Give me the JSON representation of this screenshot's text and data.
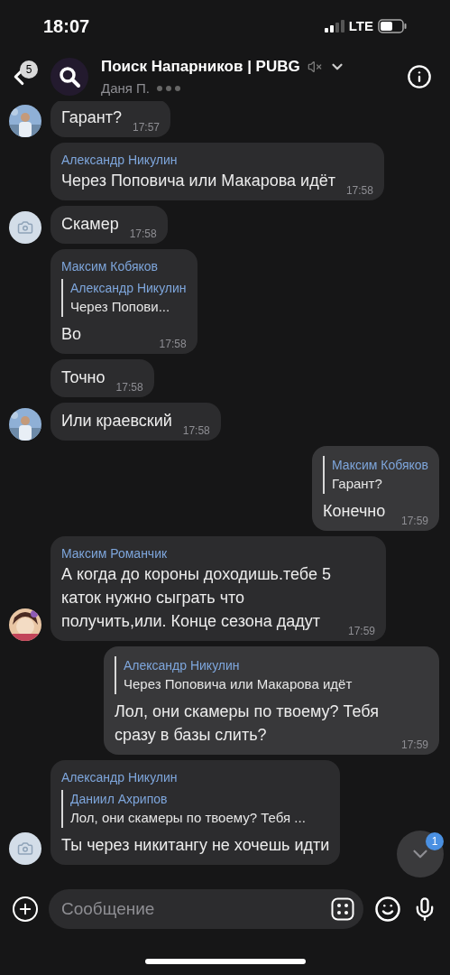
{
  "status_bar": {
    "time": "18:07",
    "network": "LTE"
  },
  "header": {
    "back_badge": "5",
    "title": "Поиск Напарников | PUBG",
    "muted": true,
    "subtitle": "Даня П."
  },
  "messages": [
    {
      "kind": "incoming",
      "text": "Гарант?",
      "time": "17:57"
    },
    {
      "kind": "incoming",
      "author": "Александр Никулин",
      "text": "Через Поповича  или Макарова идёт",
      "time": "17:58"
    },
    {
      "kind": "incoming",
      "avatar": {
        "kind": "camera"
      },
      "text": "Скамер",
      "time": "17:58"
    },
    {
      "kind": "incoming",
      "author": "Максим Кобяков",
      "reply": {
        "author": "Александр Никулин",
        "text": "Через Попови..."
      },
      "text": "Во",
      "time": "17:58"
    },
    {
      "kind": "incoming",
      "text": "Точно",
      "time": "17:58"
    },
    {
      "kind": "incoming",
      "text": "Или краевский",
      "time": "17:58"
    },
    {
      "kind": "outgoing",
      "reply": {
        "author": "Максим Кобяков",
        "text": "Гарант?"
      },
      "text": "Конечно",
      "time": "17:59"
    },
    {
      "kind": "incoming",
      "avatar": {
        "kind": "drawing"
      },
      "author": "Максим Романчик",
      "text": "А когда до короны доходишь.тебе 5 каток нужно сыграть что получить,или. Конце сезона дадут",
      "time": "17:59"
    },
    {
      "kind": "outgoing",
      "reply": {
        "author": "Александр Никулин",
        "text": "Через Поповича или Макарова идёт"
      },
      "text": "Лол, они скамеры по твоему? Тебя сразу в базы слить?",
      "time": "17:59"
    },
    {
      "kind": "incoming",
      "avatar": {
        "kind": "camera"
      },
      "author": "Александр Никулин",
      "reply": {
        "author": "Даниил Ахрипов",
        "text": "Лол, они скамеры по твоему? Тебя ..."
      },
      "text": "Ты через никитангу не хочешь идти"
    }
  ],
  "scroll_button": {
    "badge": "1"
  },
  "composer": {
    "placeholder": "Сообщение"
  }
}
